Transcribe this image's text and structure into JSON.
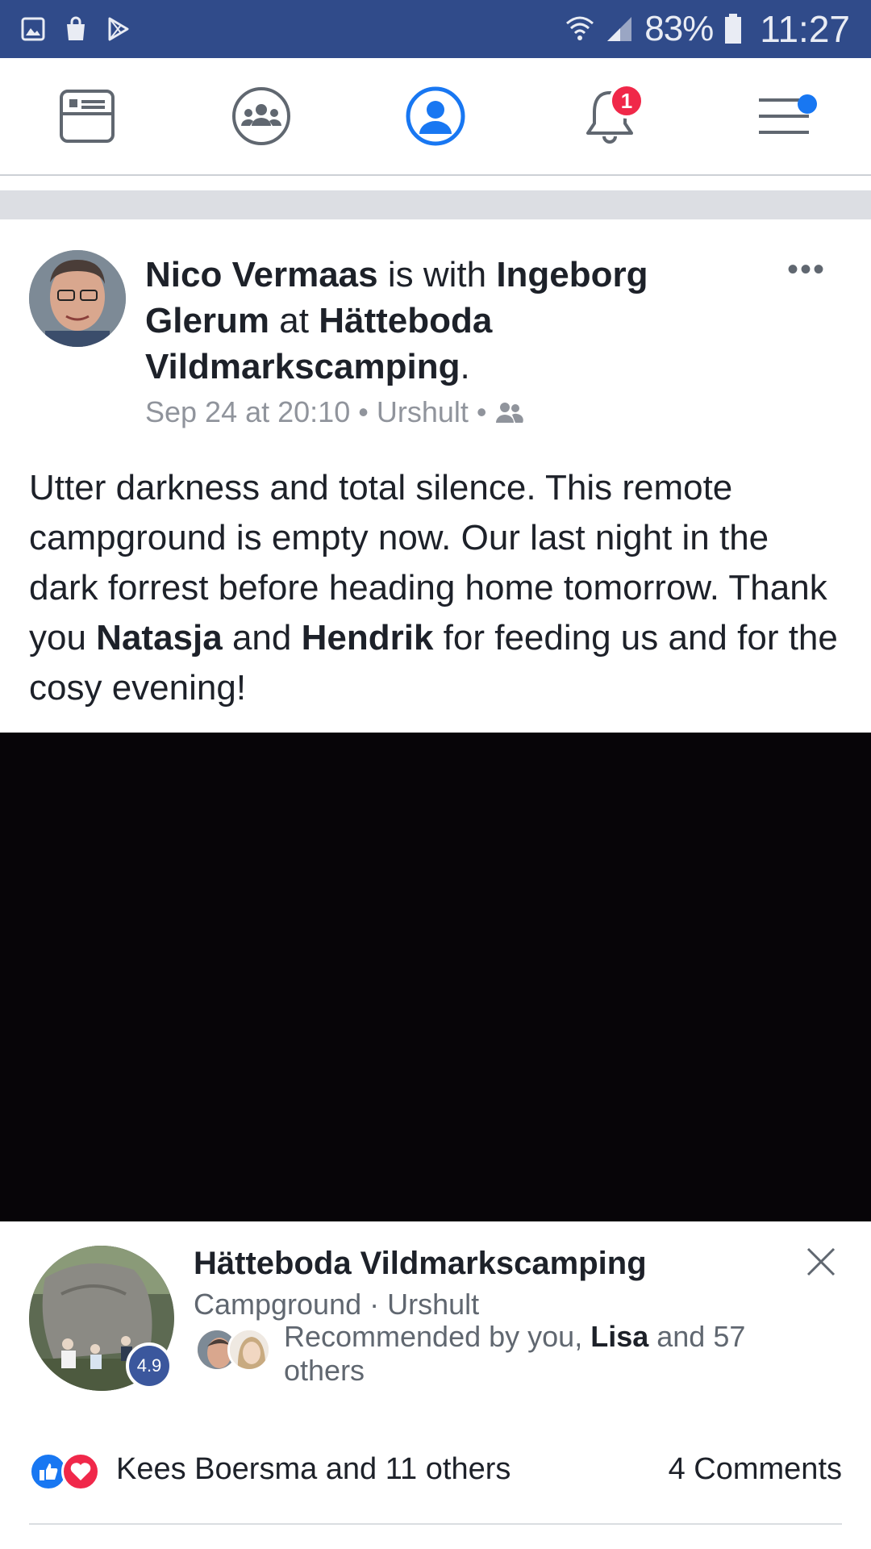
{
  "status_bar": {
    "battery_percent": "83%",
    "time": "11:27",
    "icons": [
      "gallery-icon",
      "shopping-bag-icon",
      "play-store-icon",
      "wifi-icon",
      "signal-icon",
      "battery-icon"
    ]
  },
  "nav": {
    "items": [
      {
        "name": "news-feed-icon"
      },
      {
        "name": "groups-icon"
      },
      {
        "name": "profile-icon",
        "active": true
      },
      {
        "name": "notifications-icon",
        "badge": "1"
      },
      {
        "name": "menu-icon",
        "dot": true
      }
    ],
    "active_color": "#1877f2",
    "badge_color": "#f02849"
  },
  "post": {
    "author": "Nico Vermaas",
    "with_text": " is with ",
    "tagged": "Ingeborg Glerum",
    "at_text": " at ",
    "place": "Hätteboda Vildmarkscamping",
    "end_punct": ".",
    "date": "Sep 24 at 20:10",
    "sep": "•",
    "location": "Urshult",
    "privacy_icon": "friends-icon",
    "more_label": "•••",
    "body_1": "Utter darkness and total silence. This remote campground is empty now. Our last night in the dark forrest before heading home tomorrow. Thank you ",
    "body_name_1": "Natasja",
    "body_2": " and ",
    "body_name_2": "Hendrik",
    "body_3": " for feeding us and for the cosy evening!"
  },
  "place_card": {
    "name": "Hätteboda Vildmarkscamping",
    "subtitle": "Campground · Urshult",
    "rating": "4.9",
    "rec_prefix": "Recommended by you, ",
    "rec_name": "Lisa",
    "rec_suffix": " and 57 others"
  },
  "reactions": {
    "text": "Kees Boersma and 11 others",
    "comments": "4 Comments",
    "like_color": "#1877f2",
    "love_color": "#f0284a"
  }
}
